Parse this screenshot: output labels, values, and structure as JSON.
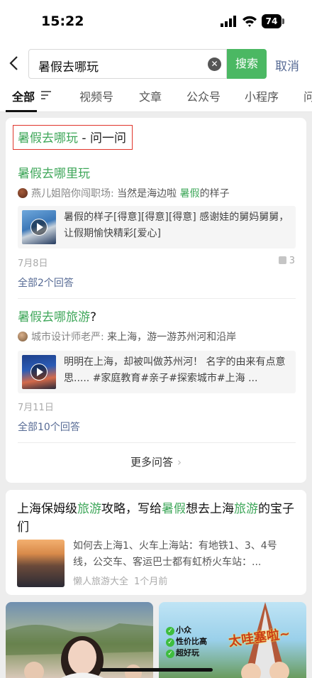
{
  "status": {
    "time": "15:22",
    "battery": "74"
  },
  "search": {
    "query": "暑假去哪玩",
    "button": "搜索",
    "cancel": "取消",
    "back_icon": "chevron-left-icon",
    "clear_icon": "clear-icon"
  },
  "tabs": {
    "items": [
      "全部",
      "视频号",
      "文章",
      "公众号",
      "小程序",
      "问"
    ],
    "active": "全部"
  },
  "qa": {
    "header_keyword": "暑假去哪玩",
    "header_suffix": " - 问一问",
    "items": [
      {
        "title_hl": "暑假去哪里玩",
        "title_rest": "",
        "author": "燕儿姐陪你闯职场:",
        "answer_pre": " 当然是海边啦 ",
        "answer_hl": "暑假",
        "answer_post": "的样子",
        "preview": "暑假的样子[得意][得意][得意] 感谢娃的舅妈舅舅，让假期愉快精彩[爱心]",
        "date": "7月8日",
        "likes": "3",
        "all_answers": "全部2个回答"
      },
      {
        "title_hl": "暑假去哪旅游",
        "title_rest": "?",
        "author": "城市设计师老严:",
        "answer_pre": " 来上海，游一游苏州河和沿岸",
        "answer_hl": "",
        "answer_post": "",
        "preview": "明明在上海，却被叫做苏州河！ 名字的由来有点意思..... #家庭教育#亲子#探索城市#上海 ...",
        "date": "7月11日",
        "likes": "",
        "all_answers": "全部10个回答"
      }
    ],
    "more": "更多问答"
  },
  "article": {
    "title_parts": [
      "上海保姆级",
      "旅游",
      "攻略，写给",
      "暑假",
      "想去上海",
      "旅游",
      "的宝子们"
    ],
    "summary": "如何去上海1、火车上海站：有地铁1、3、4号线，公交车、客运巴士都有虹桥火车站：...",
    "source": "懒人旅游大全",
    "time": "1个月前"
  },
  "videos": {
    "tags": [
      "小众",
      "性价比高",
      "超好玩"
    ],
    "banner": "太哇塞啦~"
  },
  "colors": {
    "accent": "#3fa75a",
    "link": "#576b95",
    "highlight_box": "#e0352b",
    "search_button": "#4bb863"
  }
}
